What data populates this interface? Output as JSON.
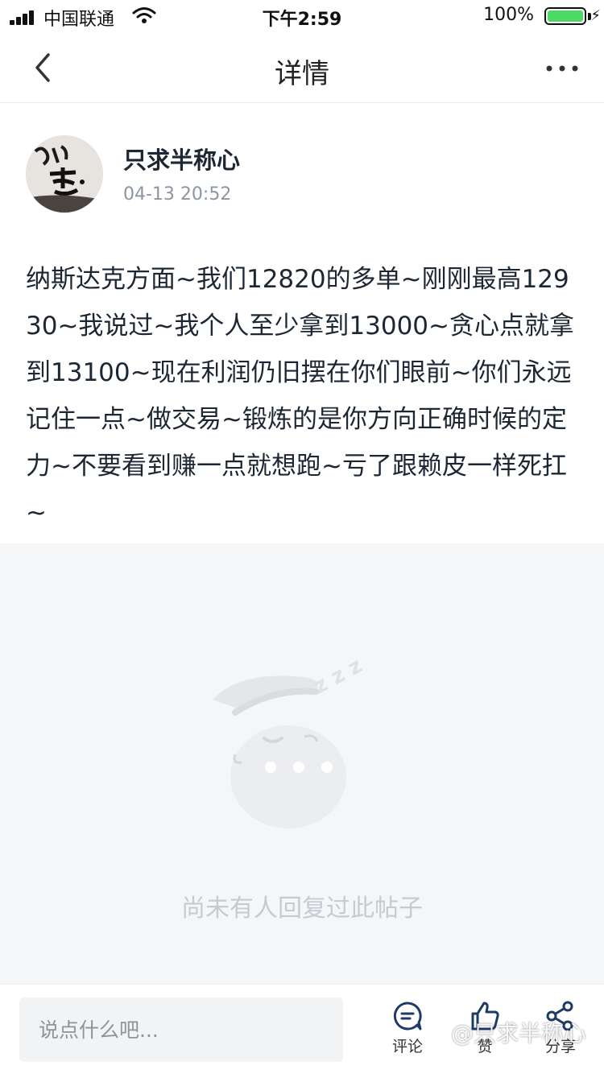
{
  "status_bar": {
    "carrier": "中国联通",
    "time": "下午2:59",
    "battery": "100%",
    "battery_level": 1.0
  },
  "nav": {
    "title": "详情",
    "back_icon": "chevron-left-icon",
    "more_icon": "more-dots-icon"
  },
  "post": {
    "author": "只求半称心",
    "time": "04-13 20:52",
    "avatar_text": "如意",
    "content": "纳斯达克方面~我们12820的多单~刚刚最高12930~我说过~我个人至少拿到13000~贪心点就拿到13100~现在利润仍旧摆在你们眼前~你们永远记住一点~做交易~锻炼的是你方向正确时候的定力~不要看到赚一点就想跑~亏了跟赖皮一样死扛~"
  },
  "replies": {
    "empty_text": "尚未有人回复过此帖子",
    "illustration": "sleeping-chat-bubble",
    "zzz": "z z z"
  },
  "bottom_bar": {
    "input_placeholder": "说点什么吧...",
    "comment_label": "评论",
    "like_label": "赞",
    "share_label": "分享"
  },
  "watermark": "@只求半称心",
  "colors": {
    "text_primary": "#1d2733",
    "text_secondary": "#8c96a3",
    "empty_bg": "#f5f6f8",
    "empty_text": "#c6cbd2",
    "battery": "#4cd964"
  }
}
